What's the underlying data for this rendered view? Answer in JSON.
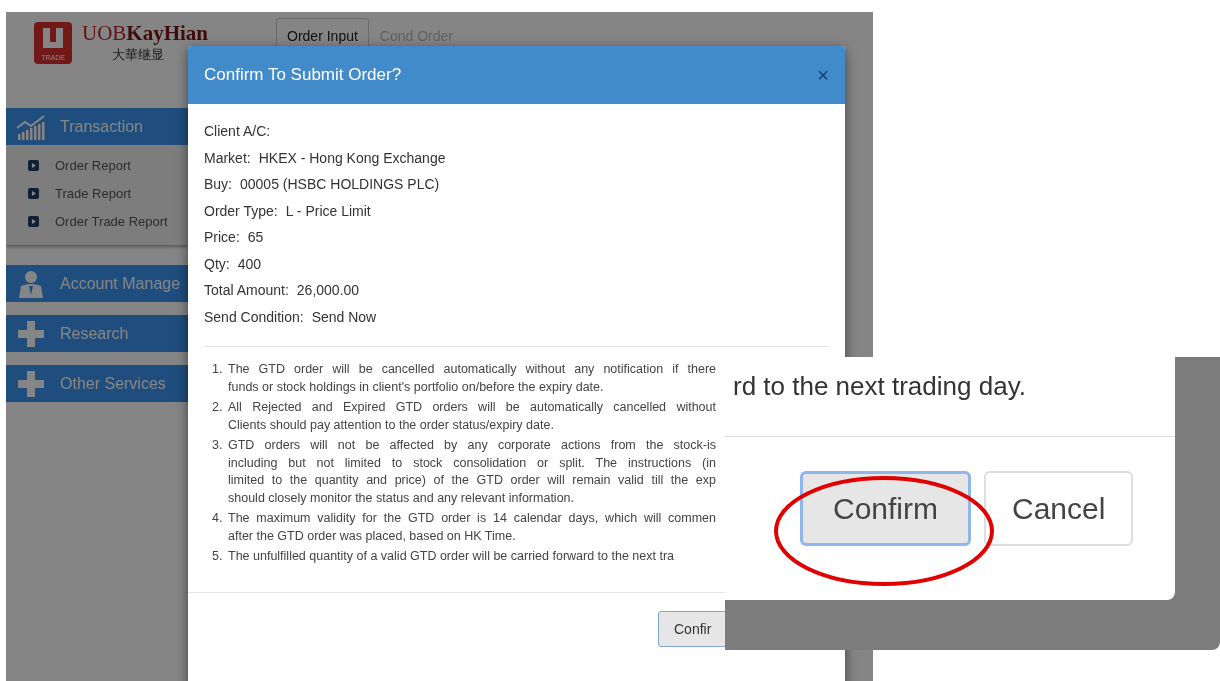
{
  "app": {
    "logo": {
      "badge_text": "TRADE",
      "brand_prefix": "UOB",
      "brand_name": "KayHian",
      "brand_chinese": "大華继显"
    },
    "tabs": [
      {
        "label": "Order Input",
        "selected": true
      },
      {
        "label": "Cond Order",
        "selected": false
      }
    ],
    "sidebar": [
      {
        "label": "Transaction",
        "kind": "chart",
        "children": [
          {
            "label": "Order Report"
          },
          {
            "label": "Trade Report"
          },
          {
            "label": "Order Trade Report"
          }
        ]
      },
      {
        "label": "Account Manage",
        "kind": "person"
      },
      {
        "label": "Research",
        "kind": "plus"
      },
      {
        "label": "Other Services",
        "kind": "plus"
      }
    ]
  },
  "dialog": {
    "title": "Confirm To Submit Order?",
    "close": "×",
    "fields": [
      {
        "label": "Client A/C:"
      },
      {
        "label": "Market:",
        "value": "HKEX - Hong Kong Exchange"
      },
      {
        "label": "Buy:",
        "value": "00005 (HSBC HOLDINGS PLC)"
      },
      {
        "label": "Order Type:",
        "value": "L - Price Limit"
      },
      {
        "label": "Price:",
        "value": "65"
      },
      {
        "label": "Qty:",
        "value": "400"
      },
      {
        "label": "Total Amount:",
        "value": "26,000.00"
      },
      {
        "label": "Send Condition:",
        "value": "Send Now"
      }
    ],
    "notes": [
      {
        "number": "1.",
        "lines": [
          "The GTD order will be cancelled automatically without any notification if there",
          "funds or stock holdings in client's portfolio on/before the expiry date."
        ]
      },
      {
        "number": "2.",
        "lines": [
          "All Rejected and Expired GTD orders will be automatically cancelled without",
          "Clients should pay attention to the order status/expiry date."
        ]
      },
      {
        "number": "3.",
        "lines": [
          "GTD orders will not be affected by any corporate actions from the stock-is",
          "including but not limited to stock consolidation or split. The instructions (in",
          "limited to the quantity and price) of the GTD order will remain valid till the exp",
          "should closely monitor the status and any relevant information."
        ]
      },
      {
        "number": "4.",
        "lines": [
          "The maximum validity for the GTD order is 14 calendar days, which will commen",
          "after the GTD order was placed, based on HK Time."
        ]
      },
      {
        "number": "5.",
        "lines": [
          "The unfulfilled quantity of a valid GTD order will be carried forward to the next tra"
        ]
      }
    ],
    "buttons": [
      {
        "label": "Confir"
      }
    ]
  },
  "zoom_inset": {
    "text": "rd to the next trading day.",
    "buttons": [
      {
        "label": "Confirm",
        "focused": true,
        "circled": true
      },
      {
        "label": "Cancel",
        "focused": false,
        "circled": false
      }
    ]
  }
}
